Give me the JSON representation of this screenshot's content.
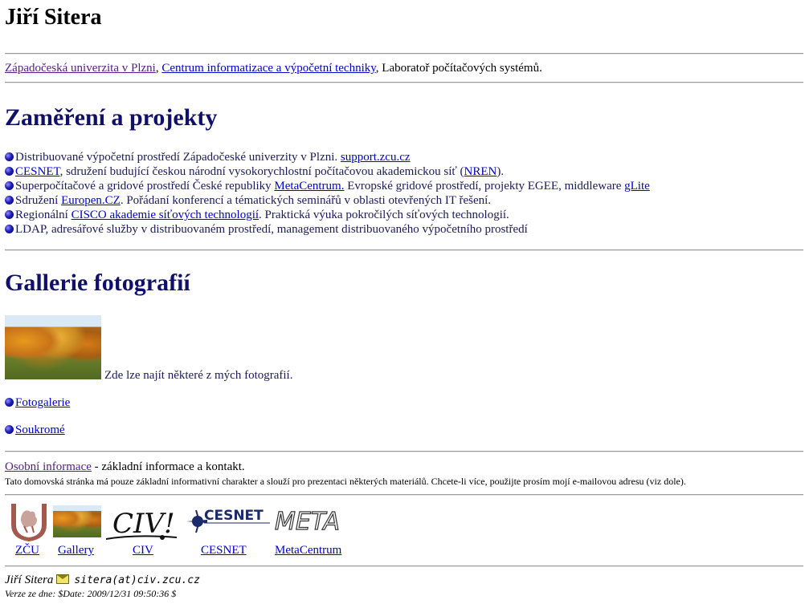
{
  "header": {
    "name": "Jiří Sitera"
  },
  "affiliation": {
    "university_link": "Západočeská univerzita v Plzni",
    "sep1": ", ",
    "center_link": "Centrum informatizace a výpočetní techniky",
    "rest": ", Laboratoř počítačových systémů."
  },
  "focus": {
    "title": "Zaměření a projekty",
    "items": [
      {
        "pre": "Distribuované výpočetní prostředí Západočeské univerzity v Plzni. ",
        "link": "support.zcu.cz",
        "post": ""
      },
      {
        "pre": "",
        "link": "CESNET",
        "post": ", sdružení budující českou národní vysokorychlostní počítačovou akademickou síť (",
        "link2": "NREN",
        "post2": ")."
      },
      {
        "pre": "Superpočítačové a gridové prostředí České republiky ",
        "link": "MetaCentrum.",
        "post": " Evropské gridové prostředí, projekty EGEE, middleware ",
        "link2": "gLite",
        "post2": ""
      },
      {
        "pre": "Sdružení ",
        "link": "Europen.CZ",
        "post": ". Pořádaní konferencí a tématických seminářů v oblasti otevřených IT řešení."
      },
      {
        "pre": "Regionální ",
        "link": "CISCO akademie síťových technologií",
        "post": ". Praktická výuka pokročilých síťových technologií."
      },
      {
        "pre": "LDAP, adresářové služby v distribuovaném prostředí, management distribuovaného výpočetního prostředí",
        "link": "",
        "post": ""
      }
    ]
  },
  "gallery": {
    "title": "Gallerie fotografií",
    "caption": " Zde lze najít některé z mých fotografií.",
    "links": [
      "Fotogalerie",
      "Soukromé"
    ]
  },
  "footer": {
    "info_link": "Osobní informace",
    "info_rest": " - základní informace a kontakt.",
    "disclaimer": "Tato domovská stránka má pouze základní informativní charakter a slouží pro prezentaci některých materiálů. Chcete-li více, použijte prosím mojí e-mailovou adresu (viz dole).",
    "logos": [
      {
        "label": "ZČU",
        "icon": "zcu-logo"
      },
      {
        "label": "Gallery",
        "icon": "gallery-thumb"
      },
      {
        "label": "CIV",
        "icon": "civ-logo",
        "text": "CIV!"
      },
      {
        "label": "CESNET",
        "icon": "cesnet-logo",
        "text": "CESNET"
      },
      {
        "label": "MetaCentrum",
        "icon": "meta-logo",
        "text": "META"
      }
    ],
    "signature_name": "Jiří Sitera",
    "email": "sitera(at)civ.zcu.cz",
    "version": "Verze ze dne: $Date: 2009/12/31 09:50:36 $"
  },
  "colors": {
    "link": "#0000cc",
    "visited": "#551a8b",
    "heading": "#10106a",
    "bullet": "#1d1db8"
  }
}
